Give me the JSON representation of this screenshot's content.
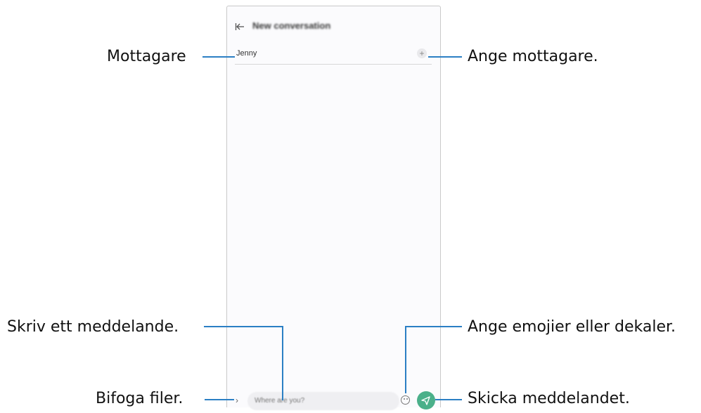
{
  "screen": {
    "title": "New conversation",
    "recipient": "Jenny",
    "input_placeholder": "Where are you?",
    "send_color": "#4bb08a",
    "icons": [
      "back-arrow-icon",
      "plus-icon",
      "chevron-right-icon",
      "emoji-icon",
      "send-icon"
    ]
  },
  "callouts": {
    "mottagare": "Mottagare",
    "ange_mottagare": "Ange mottagare.",
    "skriv": "Skriv ett meddelande.",
    "emoji": "Ange emojier eller dekaler.",
    "bifoga": "Bifoga filer.",
    "skicka": "Skicka meddelandet.",
    "line_color": "#2b7fc4"
  }
}
